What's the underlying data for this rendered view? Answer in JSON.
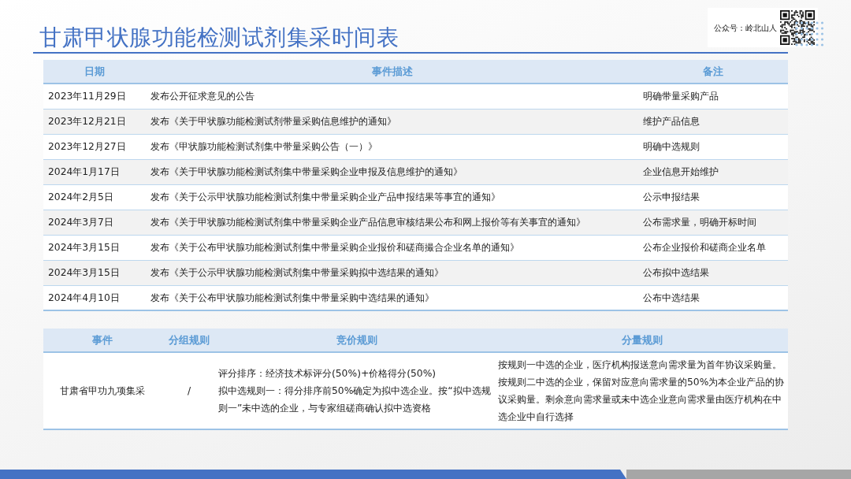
{
  "title": "甘肃甲状腺功能检测试剂集采时间表",
  "account": {
    "label": "公众号：岭北山人"
  },
  "timeline_table": {
    "columns": [
      "日期",
      "事件描述",
      "备注"
    ],
    "rows": [
      {
        "date": "2023年11月29日",
        "event": "发布公开征求意见的公告",
        "note": "明确带量采购产品"
      },
      {
        "date": "2023年12月21日",
        "event": "发布《关于甲状腺功能检测试剂带量采购信息维护的通知》",
        "note": "维护产品信息"
      },
      {
        "date": "2023年12月27日",
        "event": "发布《甲状腺功能检测试剂集中带量采购公告（一）》",
        "note": "明确中选规则"
      },
      {
        "date": "2024年1月17日",
        "event": "发布《关于甲状腺功能检测试剂集中带量采购企业申报及信息维护的通知》",
        "note": "企业信息开始维护"
      },
      {
        "date": "2024年2月5日",
        "event": "发布《关于公示甲状腺功能检测试剂集中带量采购企业产品申报结果等事宜的通知》",
        "note": "公示申报结果"
      },
      {
        "date": "2024年3月7日",
        "event": "发布《关于甲状腺功能检测试剂集中带量采购企业产品信息审核结果公布和网上报价等有关事宜的通知》",
        "note": "公布需求量，明确开标时间"
      },
      {
        "date": "2024年3月15日",
        "event": "发布《关于公布甲状腺功能检测试剂集中带量采购企业报价和磋商撮合企业名单的通知》",
        "note": "公布企业报价和磋商企业名单"
      },
      {
        "date": "2024年3月15日",
        "event": "发布《关于公示甲状腺功能检测试剂集中带量采购拟中选结果的通知》",
        "note": "公布拟中选结果"
      },
      {
        "date": "2024年4月10日",
        "event": "发布《关于公布甲状腺功能检测试剂集中带量采购中选结果的通知》",
        "note": "公布中选结果"
      }
    ]
  },
  "rules_table": {
    "columns": [
      "事件",
      "分组规则",
      "竞价规则",
      "分量规则"
    ],
    "rows": [
      {
        "event": "甘肃省甲功九项集采",
        "grouping": "/",
        "bidding": [
          "评分排序：经济技术标评分(50%)+价格得分(50%)",
          "拟中选规则一：得分排序前50%确定为拟中选企业。按“拟中选规则一”未中选的企业，与专家组磋商确认拟中选资格"
        ],
        "allocation": "按规则一中选的企业，医疗机构报送意向需求量为首年协议采购量。按规则二中选的企业，保留对应意向需求量的50%为本企业产品的协议采购量。剩余意向需求量或未中选企业意向需求量由医疗机构在中选企业中自行选择"
      }
    ]
  }
}
